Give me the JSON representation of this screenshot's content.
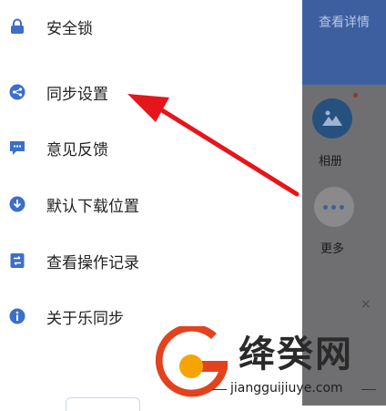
{
  "menu": {
    "items": [
      {
        "label": "安全锁",
        "icon": "lock-icon"
      },
      {
        "label": "同步设置",
        "icon": "sync-settings-icon"
      },
      {
        "label": "意见反馈",
        "icon": "feedback-icon"
      },
      {
        "label": "默认下载位置",
        "icon": "download-location-icon"
      },
      {
        "label": "查看操作记录",
        "icon": "operation-log-icon"
      },
      {
        "label": "关于乐同步",
        "icon": "about-icon"
      }
    ]
  },
  "background_app": {
    "header_text": "查看详情",
    "album_label": "相册",
    "more_label": "更多",
    "close_glyph": "×"
  },
  "watermark": {
    "title": "绛癸网",
    "url": "jiangguijiuye.com"
  },
  "colors": {
    "icon_blue": "#3b6fc9",
    "arrow_red": "#e5161b",
    "header_blue": "#3d5fa0"
  }
}
